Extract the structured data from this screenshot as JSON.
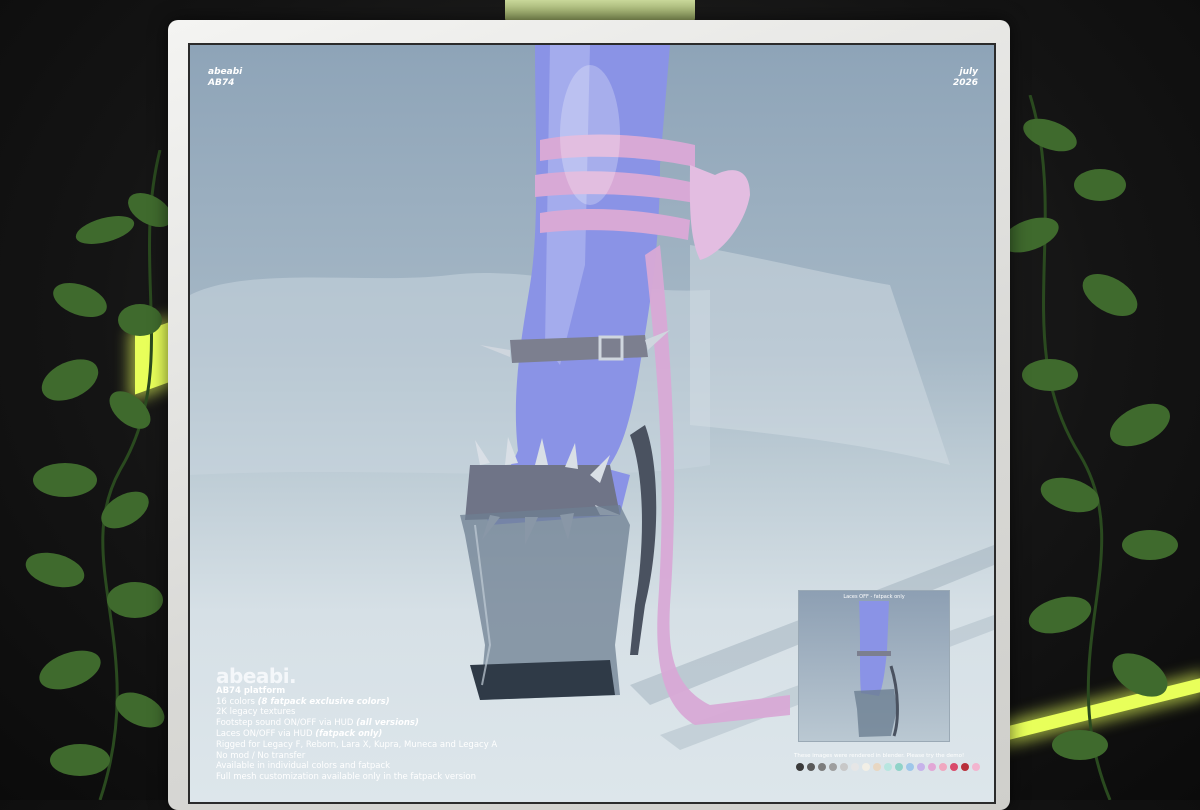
{
  "poster": {
    "brand_top": "abeabi",
    "code_top": "AB74",
    "month": "july",
    "year": "2026",
    "logo": "abeabi.",
    "product_line": "AB74 platform",
    "details": [
      {
        "text": "16 colors ",
        "bold": "(8 fatpack exclusive colors)"
      },
      {
        "text": "2K legacy textures",
        "bold": ""
      },
      {
        "text": "Footstep sound ON/OFF via HUD ",
        "bold": "(all versions)"
      },
      {
        "text": "Laces ON/OFF via HUD ",
        "bold": "(fatpack only)"
      },
      {
        "text": "Rigged for Legacy F, Reborn, Lara X, Kupra, Muneca and Legacy A",
        "bold": ""
      },
      {
        "text": "No mod / No transfer",
        "bold": ""
      },
      {
        "text": "Available in individual colors and fatpack",
        "bold": ""
      },
      {
        "text": "Full mesh customization available only in the fatpack version",
        "bold": ""
      }
    ],
    "inset_caption": "Laces OFF - fatpack only",
    "note": "These images were rendered in blender. Please try the demo!",
    "swatch_colors": [
      "#3a3a3a",
      "#5a5a5a",
      "#7d7d7d",
      "#9e9e9e",
      "#c8c8c8",
      "#e6e6e6",
      "#f2efe6",
      "#e8d7c2",
      "#b8e6e0",
      "#8fd3c8",
      "#9ec7ea",
      "#c7b3ea",
      "#e2a7d6",
      "#f0a8c0",
      "#d94a6a",
      "#b82f3a",
      "#f3b5cf"
    ]
  },
  "colors": {
    "leaf": "#3f6a2d",
    "leaf_dark": "#2a4a1f",
    "neon": "#e8ff5a",
    "ribbon": "#d8a9d6",
    "leg": "#8a93e6"
  }
}
